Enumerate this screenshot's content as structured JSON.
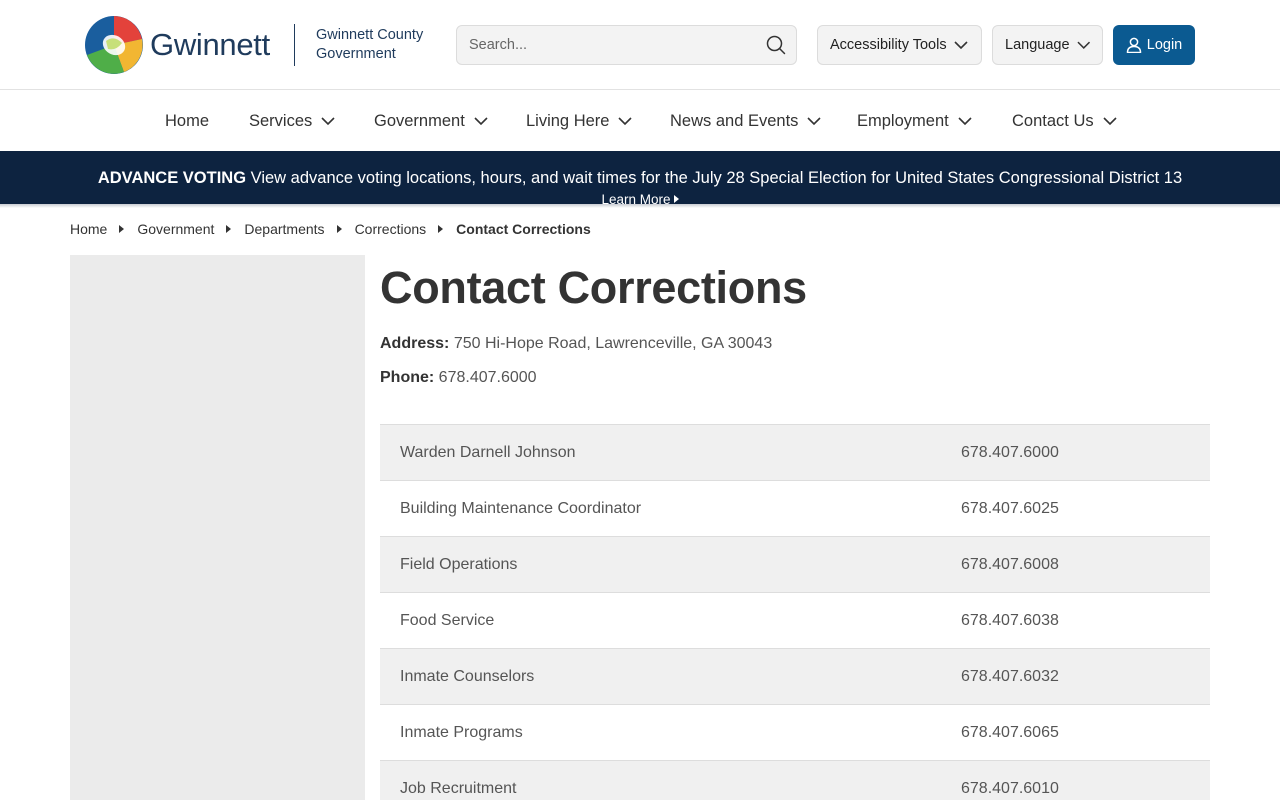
{
  "header": {
    "logo_word": "Gwinnett",
    "logo_sub_line1": "Gwinnett County",
    "logo_sub_line2": "Government",
    "search_placeholder": "Search...",
    "accessibility_label": "Accessibility Tools",
    "language_label": "Language",
    "login_label": "Login",
    "login_color": "#0b5a91"
  },
  "nav": {
    "items": [
      {
        "label": "Home"
      },
      {
        "label": "Services"
      },
      {
        "label": "Government"
      },
      {
        "label": "Living Here"
      },
      {
        "label": "News and Events"
      },
      {
        "label": "Employment"
      },
      {
        "label": "Contact Us"
      }
    ]
  },
  "alert": {
    "bold_text": "ADVANCE VOTING",
    "text": " View advance voting locations, hours, and wait times for the July 28 Special Election for United States Congressional District 13",
    "more_label": "Learn More",
    "background": "#0d2340"
  },
  "breadcrumb": {
    "items": [
      "Home",
      "Government",
      "Departments",
      "Corrections"
    ],
    "current": "Contact Corrections"
  },
  "main": {
    "title": "Contact Corrections",
    "address_label": "Address:",
    "address_value": "750 Hi-Hope Road, Lawrenceville, GA 30043",
    "phone_label": "Phone:",
    "phone_value": "678.407.6000",
    "contacts": [
      {
        "name": "Warden Darnell Johnson",
        "phone": "678.407.6000"
      },
      {
        "name": "Building Maintenance Coordinator",
        "phone": "678.407.6025"
      },
      {
        "name": "Field Operations",
        "phone": "678.407.6008"
      },
      {
        "name": "Food Service",
        "phone": "678.407.6038"
      },
      {
        "name": "Inmate Counselors",
        "phone": "678.407.6032"
      },
      {
        "name": "Inmate Programs",
        "phone": "678.407.6065"
      },
      {
        "name": "Job Recruitment",
        "phone": "678.407.6010"
      }
    ]
  }
}
